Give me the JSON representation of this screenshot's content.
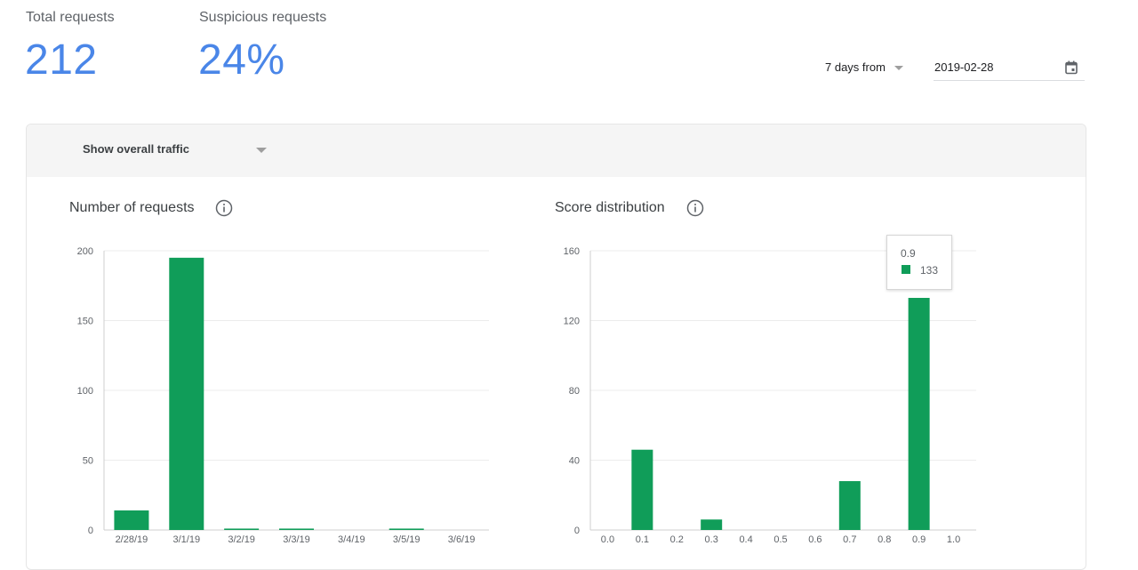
{
  "stats": {
    "total_label": "Total requests",
    "total_value": "212",
    "suspicious_label": "Suspicious requests",
    "suspicious_value": "24%"
  },
  "controls": {
    "range_label": "7 days from",
    "date_value": "2019-02-28",
    "traffic_label": "Show overall traffic"
  },
  "colors": {
    "accent": "#4a86e8",
    "bar": "#109d59",
    "header_bg": "#f5f5f5"
  },
  "chart_data": [
    {
      "type": "bar",
      "title": "Number of requests",
      "categories": [
        "2/28/19",
        "3/1/19",
        "3/2/19",
        "3/3/19",
        "3/4/19",
        "3/5/19",
        "3/6/19"
      ],
      "values": [
        14,
        195,
        1,
        1,
        0,
        1,
        0
      ],
      "ylim": [
        0,
        200
      ],
      "yticks": [
        0,
        50,
        100,
        150,
        200
      ],
      "grid": true
    },
    {
      "type": "bar",
      "title": "Score distribution",
      "categories": [
        "0.0",
        "0.1",
        "0.2",
        "0.3",
        "0.4",
        "0.5",
        "0.6",
        "0.7",
        "0.8",
        "0.9",
        "1.0"
      ],
      "values": [
        0,
        46,
        0,
        6,
        0,
        0,
        0,
        28,
        0,
        133,
        0
      ],
      "ylim": [
        0,
        160
      ],
      "yticks": [
        0,
        40,
        80,
        120,
        160
      ],
      "grid": true,
      "tooltip": {
        "category": "0.9",
        "value": "133"
      }
    }
  ]
}
